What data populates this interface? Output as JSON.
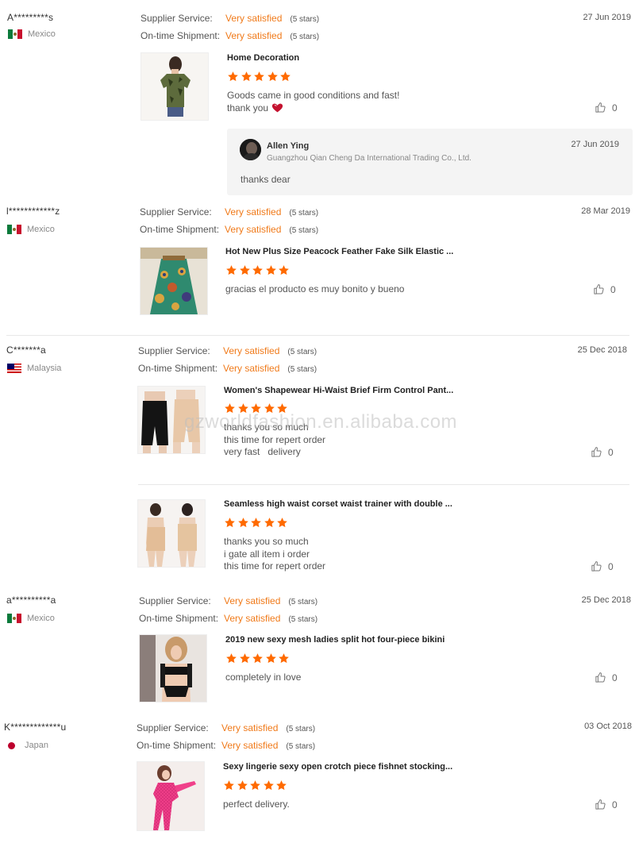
{
  "labels": {
    "supplier_service": "Supplier Service:",
    "ontime_shipment": "On-time Shipment:",
    "very_satisfied": "Very satisfied",
    "five_stars": "(5 stars)"
  },
  "watermark": "gzworldfashion.en.alibaba.com",
  "colors": {
    "accent": "#f07a1a",
    "star": "#ff6a00"
  },
  "reviews": [
    {
      "reviewer": "A*********s",
      "country": "Mexico",
      "date": "27 Jun 2019",
      "products": [
        {
          "title": "Home Decoration",
          "comment": [
            "Goods came in good conditions and fast!",
            "thank you"
          ],
          "likes": "0",
          "heart_icon": "heart-icon"
        }
      ],
      "reply": {
        "name": "Allen Ying",
        "company": "Guangzhou Qian Cheng Da International Trading Co., Ltd.",
        "date": "27 Jun 2019",
        "text": "thanks  dear"
      }
    },
    {
      "reviewer": "l************z",
      "country": "Mexico",
      "date": "28 Mar 2019",
      "products": [
        {
          "title": "Hot New Plus Size Peacock Feather Fake Silk Elastic ...",
          "comment": [
            "gracias el producto es muy bonito y bueno"
          ],
          "likes": "0"
        }
      ]
    },
    {
      "reviewer": "C*******a",
      "country": "Malaysia",
      "date": "25 Dec 2018",
      "products": [
        {
          "title": "Women's Shapewear Hi-Waist Brief Firm Control Pant...",
          "comment": [
            "thanks you so much",
            "this time for repert order",
            "very fast   delivery"
          ],
          "likes": "0"
        },
        {
          "title": "Seamless high waist corset waist trainer with double ...",
          "comment": [
            "thanks you so much",
            "i gate all item i order",
            "this time for repert order"
          ],
          "likes": "0"
        }
      ]
    },
    {
      "reviewer": "a**********a",
      "country": "Mexico",
      "date": "25 Dec 2018",
      "products": [
        {
          "title": "2019 new sexy mesh ladies split hot four-piece bikini",
          "comment": [
            "completely in love"
          ],
          "likes": "0"
        }
      ]
    },
    {
      "reviewer": "K*************u",
      "country": "Japan",
      "date": "03 Oct 2018",
      "products": [
        {
          "title": "Sexy lingerie sexy open crotch piece fishnet stocking...",
          "comment": [
            "perfect delivery."
          ],
          "likes": "0"
        }
      ]
    }
  ]
}
